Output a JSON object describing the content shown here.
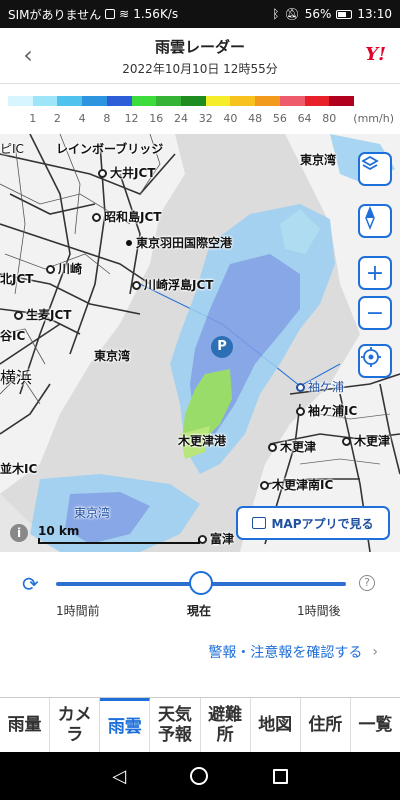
{
  "status_bar": {
    "carrier": "SIMがありません",
    "speed": "1.56K/s",
    "battery": "56%",
    "time": "13:10"
  },
  "header": {
    "title": "雨雲レーダー",
    "datetime": "2022年10月10日 12時55分",
    "logo": "Y!"
  },
  "legend": {
    "colors": [
      "#d6f5ff",
      "#9de6f9",
      "#4fc3ee",
      "#2d95e0",
      "#2d5ed8",
      "#3cdc3c",
      "#34b334",
      "#1e8c1e",
      "#f5ec2a",
      "#f7c21e",
      "#f29a1c",
      "#ee5c6c",
      "#e8202a",
      "#b0001e"
    ],
    "labels": [
      "1",
      "2",
      "4",
      "8",
      "12",
      "16",
      "24",
      "32",
      "40",
      "48",
      "56",
      "64",
      "80"
    ],
    "unit": "(mm/h)"
  },
  "map": {
    "labels": {
      "jct_ohi": "大井JCT",
      "showajima_jct": "昭和島JCT",
      "haneda": "東京羽田国際空港",
      "kawasaki": "川崎",
      "kawasakiukishima_jct": "川崎浮島JCT",
      "namamugi_jct": "生麦JCT",
      "left_jct": "北JCT",
      "yokohama": "横浜",
      "left_ic_top": "ピIC",
      "left_ic_mid": "谷IC",
      "rainbow_bridge": "レインボーブリッジ",
      "tokyowan_top": "東京湾",
      "tokyowan_mid": "東京湾",
      "tokyowan_bottom": "東京湾",
      "sodegaura": "袖ケ浦",
      "sodegaura_ic": "袖ケ浦IC",
      "kisarazu_port": "木更津港",
      "kisarazu": "木更津",
      "kisarazu_jct": "木更津",
      "kisarazu_minami_ic": "木更津南IC",
      "futtsu": "富津",
      "namiki_ic": "並木IC",
      "parking": "P"
    },
    "scale_label": "10 km",
    "mapapp_button": "MAPアプリで見る"
  },
  "controls": {
    "layers_icon": "layers-icon",
    "compass_icon": "compass-icon",
    "zoom_in": "+",
    "zoom_out": "−",
    "locate_icon": "locate-icon"
  },
  "timeline": {
    "before": "1時間前",
    "now": "現在",
    "after": "1時間後",
    "position": 0.5,
    "warning_link": "警報・注意報を確認する"
  },
  "bottom_nav": [
    {
      "label": "雨量",
      "active": false
    },
    {
      "label": "カメラ",
      "active": false
    },
    {
      "label": "雨雲",
      "active": true
    },
    {
      "label": "天気予報",
      "active": false
    },
    {
      "label": "避難所",
      "active": false
    },
    {
      "label": "地図",
      "active": false
    },
    {
      "label": "住所",
      "active": false
    },
    {
      "label": "一覧",
      "active": false
    }
  ]
}
